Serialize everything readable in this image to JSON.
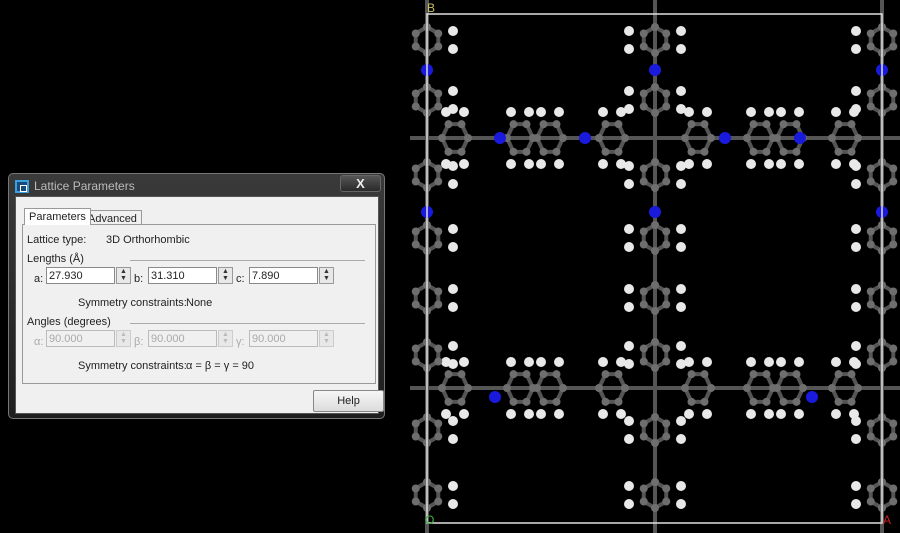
{
  "dialog": {
    "title": "Lattice Parameters",
    "close_label": "X",
    "tabs": [
      {
        "label": "Parameters",
        "active": true
      },
      {
        "label": "Advanced",
        "active": false
      }
    ],
    "lattice_type_label": "Lattice type:",
    "lattice_type_value": "3D Orthorhombic",
    "lengths_label": "Lengths (Å)",
    "lengths": [
      {
        "label": "a:",
        "value": "27.930"
      },
      {
        "label": "b:",
        "value": "31.310"
      },
      {
        "label": "c:",
        "value": "7.890"
      }
    ],
    "lengths_symmetry_label": "Symmetry constraints:",
    "lengths_symmetry_value": "None",
    "angles_label": "Angles (degrees)",
    "angles": [
      {
        "label": "α:",
        "value": "90.000"
      },
      {
        "label": "β:",
        "value": "90.000"
      },
      {
        "label": "γ:",
        "value": "90.000"
      }
    ],
    "angles_symmetry_label": "Symmetry constraints:",
    "angles_symmetry_value": "α = β = γ = 90",
    "help_label": "Help"
  },
  "viewer": {
    "axis_labels": {
      "b": "B",
      "origin": "O",
      "a": "A"
    },
    "colors": {
      "carbon": "#6e6e6e",
      "hydrogen": "#e8e8e8",
      "nitrogen": "#1a1adc",
      "cell": "#e0e0e0"
    }
  }
}
